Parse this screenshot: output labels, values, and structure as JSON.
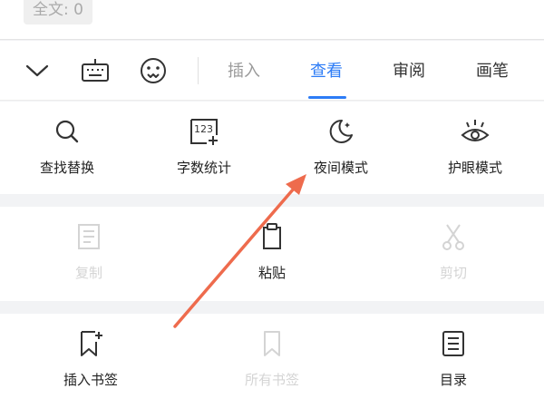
{
  "status": {
    "word_count": "全文: 0"
  },
  "toolbar": {
    "icons": [
      "collapse-chevron-icon",
      "keyboard-icon",
      "emoji-face-icon"
    ],
    "tabs": [
      {
        "label": "插入",
        "state": "dim"
      },
      {
        "label": "查看",
        "state": "active"
      },
      {
        "label": "审阅",
        "state": "normal"
      },
      {
        "label": "画笔",
        "state": "normal"
      }
    ]
  },
  "view_tools": {
    "find_replace": "查找替换",
    "word_stats": "字数统计",
    "night_mode": "夜间模式",
    "eye_care": "护眼模式",
    "word_stats_icon_text": "123"
  },
  "edit_tools": {
    "copy": "复制",
    "paste": "粘贴",
    "cut": "剪切"
  },
  "bookmark_tools": {
    "insert_bookmark": "插入书签",
    "all_bookmarks": "所有书签",
    "toc": "目录"
  },
  "colors": {
    "accent": "#2d7cf6",
    "arrow": "#ee6b4d",
    "disabled": "#d4d4d4"
  }
}
